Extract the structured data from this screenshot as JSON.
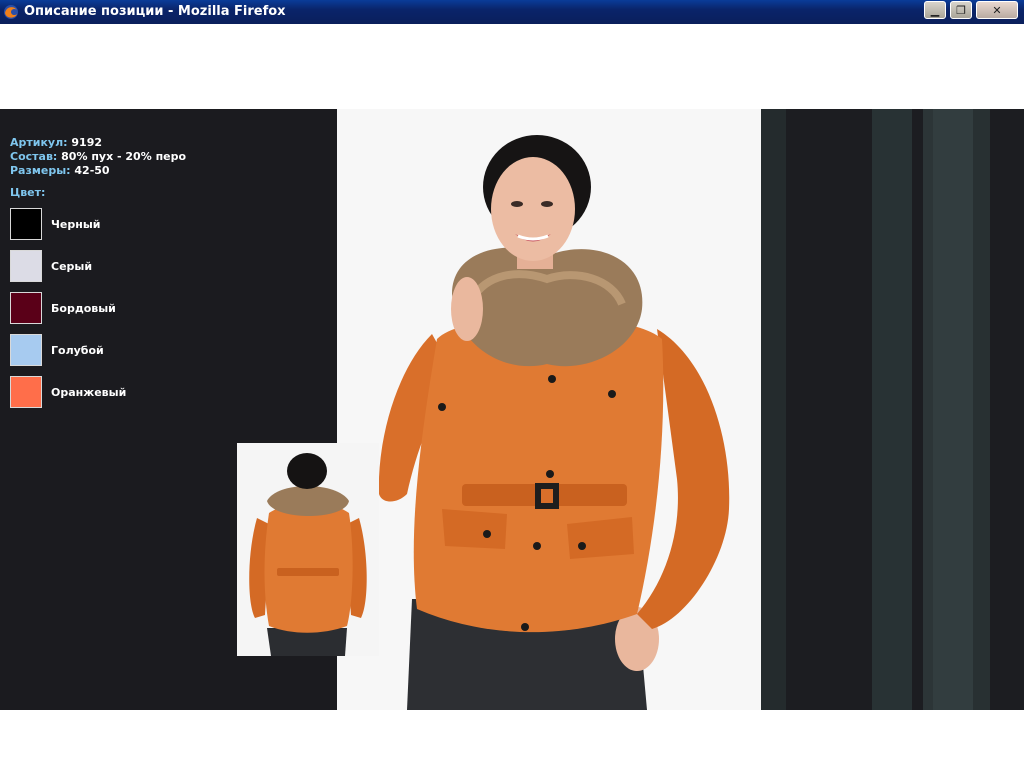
{
  "window": {
    "title": "Описание позиции - Mozilla Firefox",
    "minimize_icon": "minimize-icon",
    "maximize_icon": "restore-icon",
    "close_icon": "close-icon"
  },
  "product": {
    "article_label": "Артикул:",
    "article_value": "9192",
    "composition_label": "Состав:",
    "composition_value": "80% пух - 20% перо",
    "sizes_label": "Размеры:",
    "sizes_value": "42-50"
  },
  "colors": {
    "title": "Цвет:",
    "items": [
      {
        "label": "Черный",
        "hex": "#000000"
      },
      {
        "label": "Серый",
        "hex": "#dcdce6"
      },
      {
        "label": "Бордовый",
        "hex": "#5a0018"
      },
      {
        "label": "Голубой",
        "hex": "#a7cbf0"
      },
      {
        "label": "Оранжевый",
        "hex": "#ff6e4a"
      }
    ]
  },
  "photos": {
    "main": "model-front-photo",
    "thumbnail": "model-back-photo"
  },
  "theme": {
    "accent": "#7fc6ee",
    "background": "#1b1b1f",
    "titlebar": "#0a246a"
  }
}
